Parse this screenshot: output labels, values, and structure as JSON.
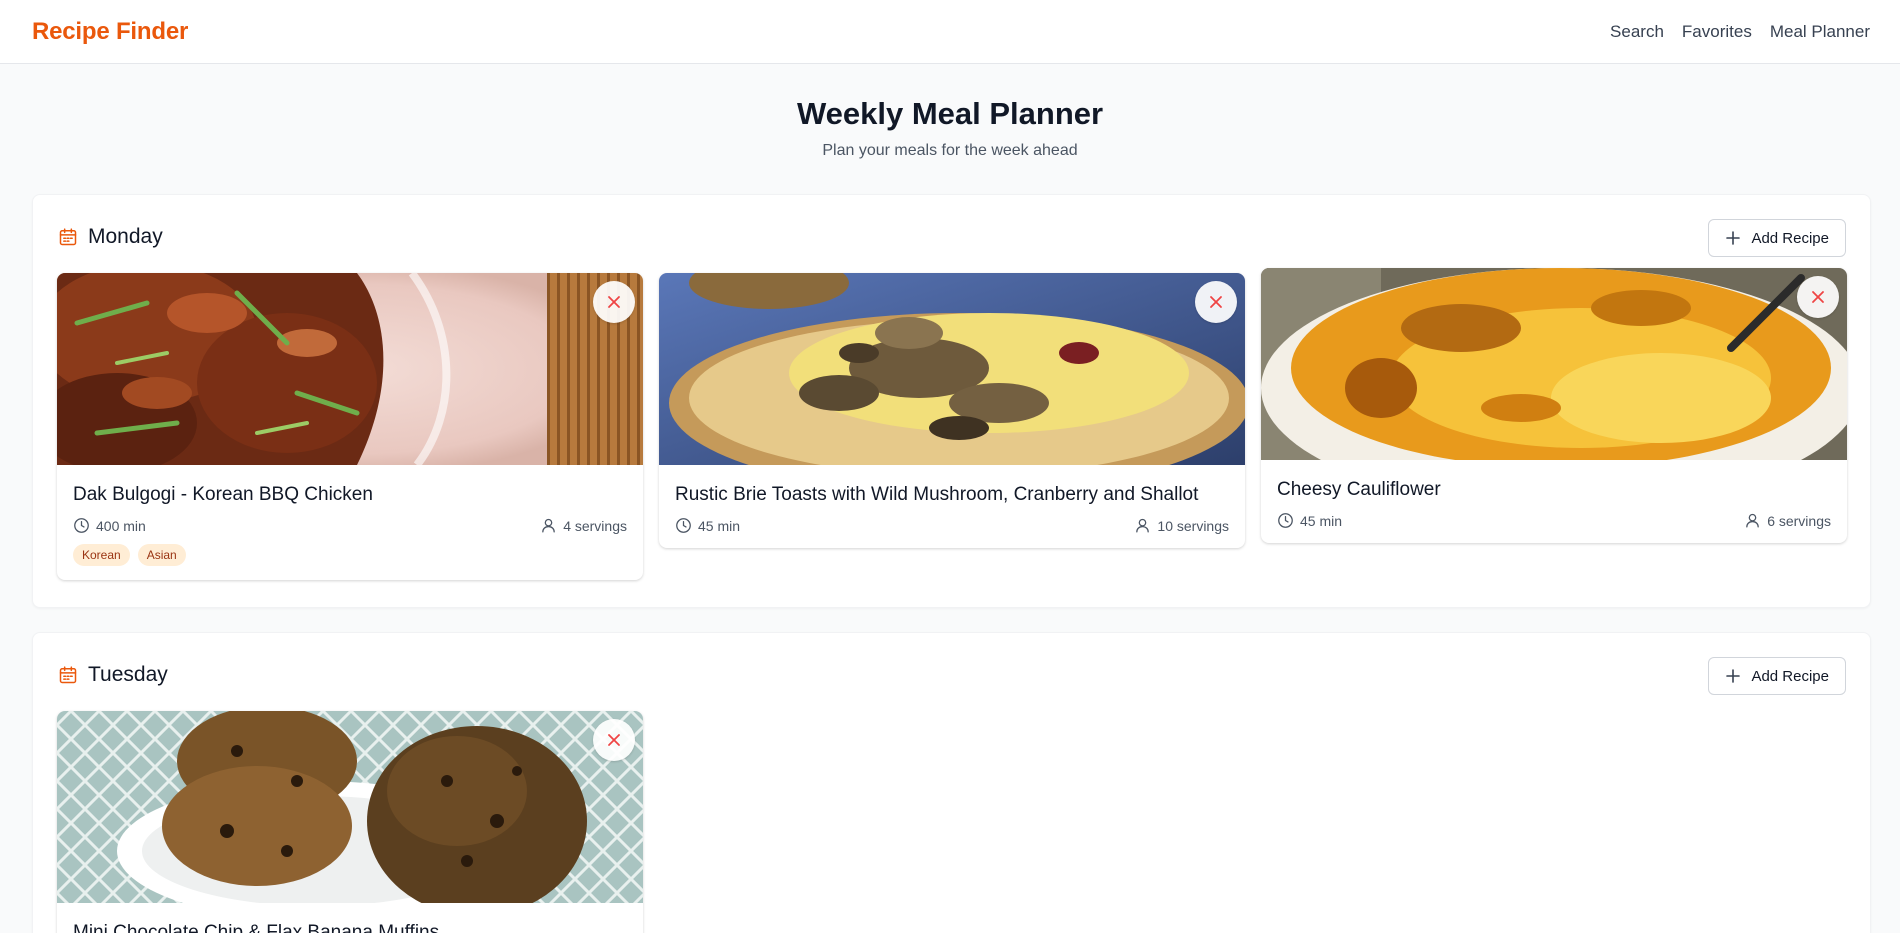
{
  "app": {
    "brand": "Recipe Finder"
  },
  "nav": {
    "items": [
      "Search",
      "Favorites",
      "Meal Planner"
    ]
  },
  "page": {
    "title": "Weekly Meal Planner",
    "subtitle": "Plan your meals for the week ahead"
  },
  "colors": {
    "accent": "#ea580c",
    "remove": "#ef4444",
    "tag_bg": "#ffedd5",
    "tag_text": "#9a3412"
  },
  "days": [
    {
      "name": "Monday",
      "add_label": "Add Recipe",
      "recipes": [
        {
          "title": "Dak Bulgogi - Korean BBQ Chicken",
          "time": "400 min",
          "servings": "4 servings",
          "tags": [
            "Korean",
            "Asian"
          ],
          "image": "korean-bbq-chicken-photo"
        },
        {
          "title": "Rustic Brie Toasts with Wild Mushroom, Cranberry and Shallot",
          "time": "45 min",
          "servings": "10 servings",
          "tags": [],
          "image": "brie-toast-photo"
        },
        {
          "title": "Cheesy Cauliflower",
          "time": "45 min",
          "servings": "6 servings",
          "tags": [],
          "image": "cheesy-cauliflower-photo"
        }
      ]
    },
    {
      "name": "Tuesday",
      "add_label": "Add Recipe",
      "recipes": [
        {
          "title": "Mini Chocolate Chip & Flax Banana Muffins",
          "time": "",
          "servings": "",
          "tags": [],
          "image": "banana-muffins-photo"
        }
      ]
    }
  ],
  "icons": {
    "calendar": "calendar-icon",
    "plus": "plus-icon",
    "clock": "clock-icon",
    "user": "user-icon",
    "remove": "close-icon"
  }
}
